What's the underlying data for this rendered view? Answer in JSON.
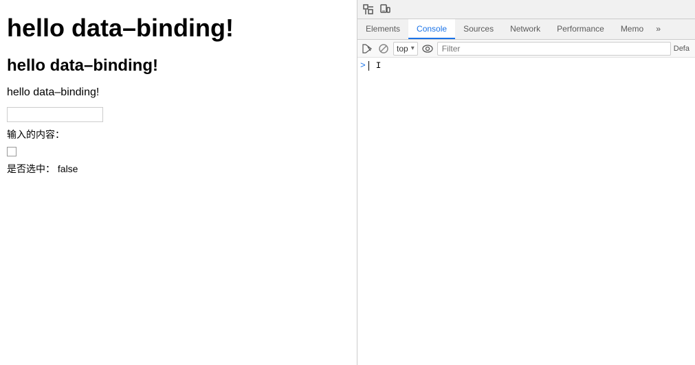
{
  "main": {
    "heading_large": "hello data–binding!",
    "heading_medium": "hello data–binding!",
    "heading_small": "hello data–binding!",
    "input_value": "",
    "input_placeholder": "",
    "label_input": "输入的内容：",
    "label_checkbox": "是否选中：",
    "checkbox_value": "false"
  },
  "devtools": {
    "top_icons": {
      "inspect_label": "⬚",
      "device_label": "⬜"
    },
    "tabs": [
      {
        "label": "Elements",
        "active": false
      },
      {
        "label": "Console",
        "active": true
      },
      {
        "label": "Sources",
        "active": false
      },
      {
        "label": "Network",
        "active": false
      },
      {
        "label": "Performance",
        "active": false
      },
      {
        "label": "Memo",
        "active": false
      }
    ],
    "console_bar": {
      "play_icon": "▶",
      "block_icon": "🚫",
      "top_selector": "top",
      "dropdown_arrow": "▾",
      "eye_icon": "👁",
      "filter_placeholder": "Filter",
      "default_label": "Defa"
    },
    "console_prompt": ">",
    "cursor_char": "|"
  }
}
